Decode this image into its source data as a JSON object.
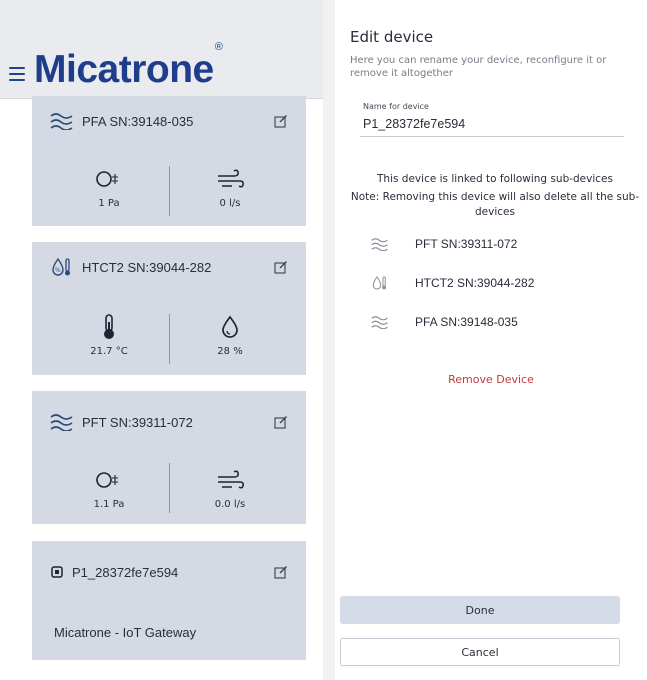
{
  "left": {
    "brand": "Micatrone",
    "brand_mark": "®",
    "cards": [
      {
        "title": "PFA SN:39148-035",
        "metrics": [
          {
            "icon": "pressure-icon",
            "value": "1 Pa"
          },
          {
            "icon": "airflow-icon",
            "value": "0 l/s"
          }
        ]
      },
      {
        "title": "HTCT2 SN:39044-282",
        "metrics": [
          {
            "icon": "thermometer-icon",
            "value": "21.7 °C"
          },
          {
            "icon": "humidity-drop-icon",
            "value": "28 %"
          }
        ]
      },
      {
        "title": "PFT SN:39311-072",
        "metrics": [
          {
            "icon": "pressure-icon",
            "value": "1.1 Pa"
          },
          {
            "icon": "airflow-icon",
            "value": "0.0 l/s"
          }
        ]
      },
      {
        "title": "P1_28372fe7e594",
        "subtitle": "Micatrone - IoT Gateway"
      }
    ]
  },
  "dialog": {
    "title": "Edit device",
    "description": "Here you can rename your device, reconfigure it or remove it altogether",
    "name_label": "Name for device",
    "name_value": "P1_28372fe7e594",
    "linked_text": "This device is linked to following sub-devices",
    "warning_text": "Note: Removing this device will also delete all the sub-devices",
    "sub_devices": [
      {
        "icon": "airflow-wave-icon",
        "name": "PFT SN:39311-072"
      },
      {
        "icon": "temp-humidity-icon",
        "name": "HTCT2 SN:39044-282"
      },
      {
        "icon": "airflow-wave-icon",
        "name": "PFA SN:39148-035"
      }
    ],
    "remove_label": "Remove Device",
    "done_label": "Done",
    "cancel_label": "Cancel"
  },
  "colors": {
    "brand": "#1e3e8c",
    "card": "#d4d9e4",
    "danger": "#c23a3a"
  }
}
